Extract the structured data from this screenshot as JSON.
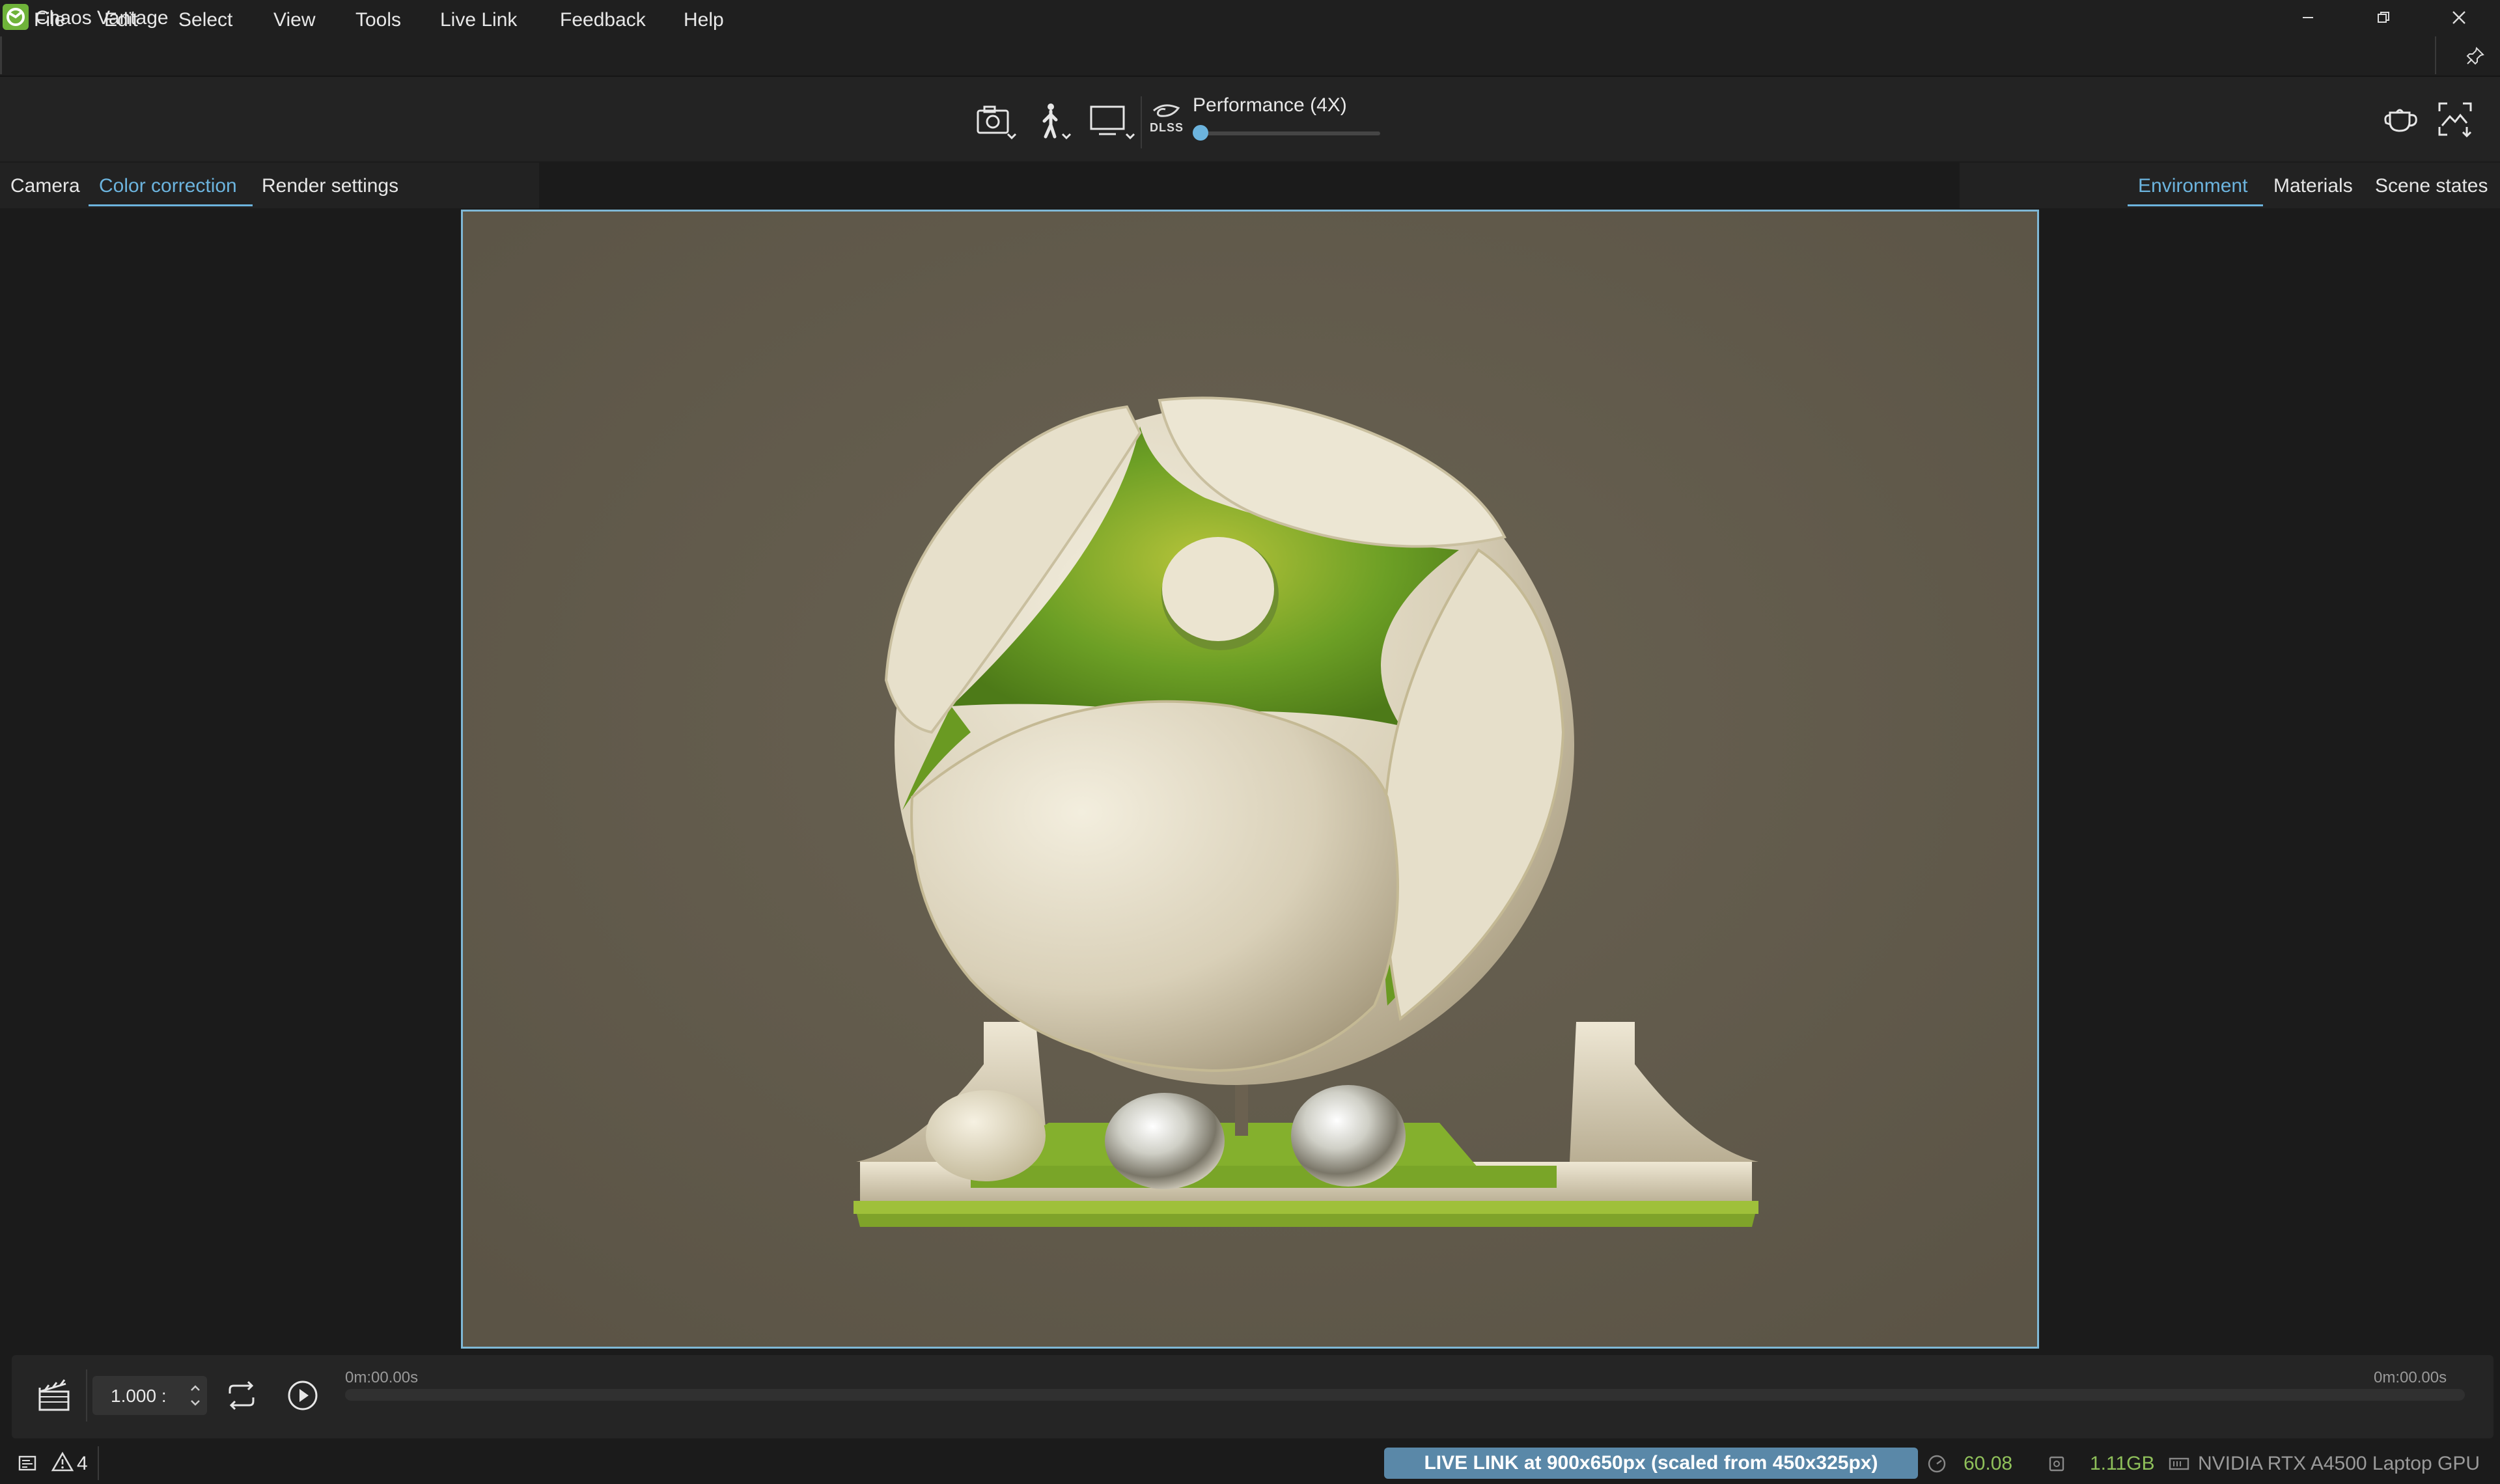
{
  "window": {
    "title": "Chaos Vantage",
    "controls": [
      "minimize",
      "restore",
      "close"
    ]
  },
  "menu": [
    "File",
    "Edit",
    "Select",
    "View",
    "Tools",
    "Live Link",
    "Feedback",
    "Help"
  ],
  "toolbar": {
    "icons": [
      "camera-icon",
      "walk-mode-icon",
      "display-icon",
      "dlss-icon"
    ],
    "performance_label": "Performance (4X)",
    "dlss_label": "DLSS",
    "quality_level": 0.0,
    "right_icons": [
      "teapot-icon",
      "image-export-icon"
    ]
  },
  "left_tabs": [
    {
      "label": "Camera",
      "active": false
    },
    {
      "label": "Color correction",
      "active": true
    },
    {
      "label": "Render settings",
      "active": false
    }
  ],
  "right_tabs": [
    {
      "label": "Environment",
      "active": true
    },
    {
      "label": "Materials",
      "active": false
    },
    {
      "label": "Scene states",
      "active": false
    }
  ],
  "timeline": {
    "speed": "1.000 :",
    "start_time": "0m:00.00s",
    "end_time": "0m:00.00s",
    "progress": 0.0
  },
  "status": {
    "warning_count": "4",
    "live_link": "LIVE LINK at 900x650px (scaled from 450x325px)",
    "fps": "60.08",
    "memory": "1.11GB",
    "gpu": "NVIDIA RTX A4500 Laptop GPU"
  },
  "colors": {
    "accent": "#6cb4de",
    "brand_green": "#6fb33a",
    "status_green": "#8fc05a",
    "viewport_bg": "#615a4b",
    "live_badge": "#5a88a8"
  }
}
